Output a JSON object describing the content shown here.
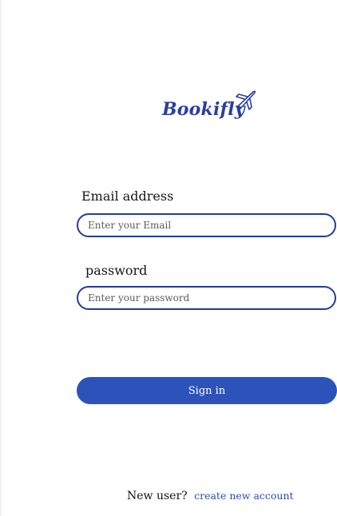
{
  "logo": {
    "text": "Bookifly",
    "icon": "airplane-icon",
    "color": "#2a3e9e"
  },
  "form": {
    "email": {
      "label": "Email address",
      "placeholder": "Enter your Email",
      "value": ""
    },
    "password": {
      "label": "password",
      "placeholder": "Enter your password",
      "value": ""
    },
    "submit_label": "Sign in"
  },
  "footer": {
    "prompt": "New user?",
    "link_label": "create new account"
  },
  "colors": {
    "accent": "#2d52ba",
    "field_border": "#253b9c",
    "link": "#2b4db0"
  }
}
